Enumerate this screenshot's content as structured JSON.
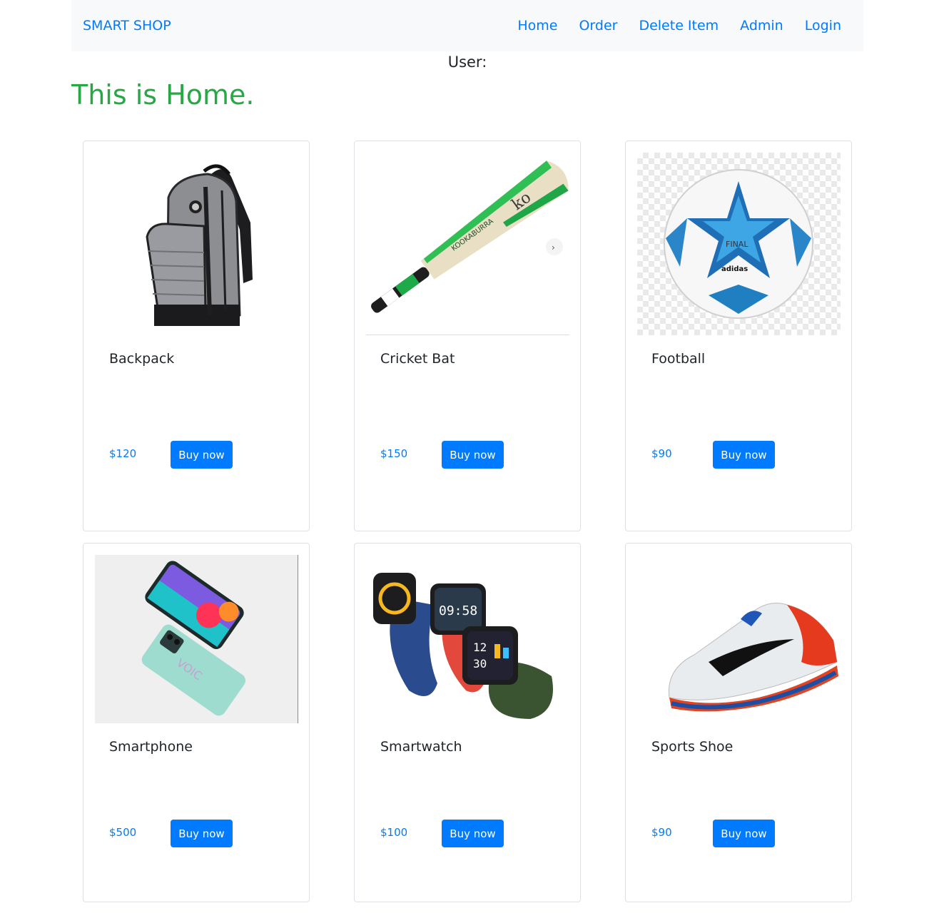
{
  "nav": {
    "brand": "SMART SHOP",
    "links": [
      "Home",
      "Order",
      "Delete Item",
      "Admin",
      "Login"
    ]
  },
  "user_label": "User:",
  "page_title": "This is Home.",
  "colors": {
    "link": "#007bff",
    "title": "#28a745",
    "navbar_bg": "#f8f9fa",
    "button_bg": "#007bff"
  },
  "products": [
    {
      "name": "Backpack",
      "price": "$120",
      "button": "Buy now",
      "image_icon": "backpack-icon"
    },
    {
      "name": "Cricket Bat",
      "price": "$150",
      "button": "Buy now",
      "image_icon": "cricket-bat-icon"
    },
    {
      "name": "Football",
      "price": "$90",
      "button": "Buy now",
      "image_icon": "football-icon"
    },
    {
      "name": "Smartphone",
      "price": "$500",
      "button": "Buy now",
      "image_icon": "smartphone-icon"
    },
    {
      "name": "Smartwatch",
      "price": "$100",
      "button": "Buy now",
      "image_icon": "smartwatch-icon"
    },
    {
      "name": "Sports Shoe",
      "price": "$90",
      "button": "Buy now",
      "image_icon": "sports-shoe-icon"
    }
  ]
}
